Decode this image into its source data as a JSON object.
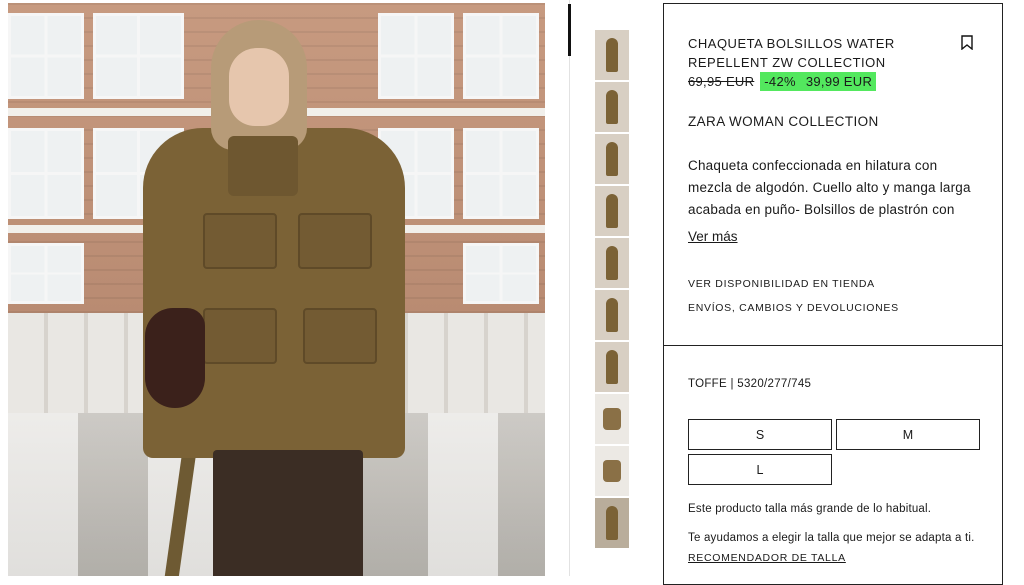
{
  "product": {
    "title": "CHAQUETA BOLSILLOS WATER REPELLENT ZW COLLECTION",
    "old_price": "69,95 EUR",
    "discount": "-42%",
    "new_price": "39,99 EUR",
    "collection": "ZARA WOMAN COLLECTION",
    "description": "Chaqueta confeccionada en hilatura con mezcla de algodón. Cuello alto y manga larga acabada en puño- Bolsillos de plastrón con",
    "see_more": "Ver más",
    "store_availability": "VER DISPONIBILIDAD EN TIENDA",
    "shipping": "ENVÍOS, CAMBIOS Y DEVOLUCIONES",
    "bookmark_icon": "bookmark-icon",
    "colors": {
      "discount_bg": "#53e85e",
      "border": "#222222"
    }
  },
  "variant": {
    "color_ref": "TOFFE | 5320/277/745",
    "sizes": [
      "S",
      "M",
      "L"
    ],
    "fit_note": "Este producto talla más grande de lo habitual.",
    "help_note": "Te ayudamos a elegir la talla que mejor se adapta a ti.",
    "recommender": "RECOMENDADOR DE TALLA"
  }
}
